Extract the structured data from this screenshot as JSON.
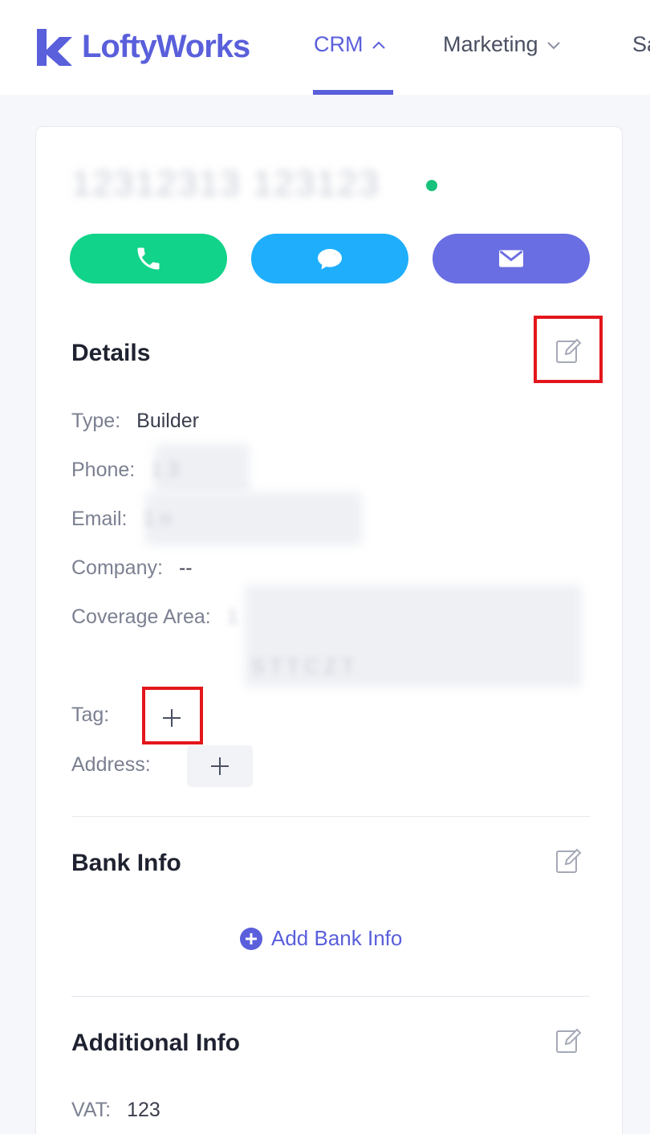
{
  "nav": {
    "logo_text": "LoftyWorks",
    "items": [
      {
        "label": "CRM",
        "active": true
      },
      {
        "label": "Marketing",
        "active": false
      },
      {
        "label": "Sa",
        "active": false
      }
    ],
    "accent_color": "#5a5fdb"
  },
  "contact": {
    "name": "12312313 123123",
    "status": "online",
    "actions": [
      {
        "icon": "phone-icon",
        "color": "#11d38a"
      },
      {
        "icon": "chat-bubble-icon",
        "color": "#1eaefb"
      },
      {
        "icon": "envelope-icon",
        "color": "#6a6ee3"
      }
    ]
  },
  "details": {
    "title": "Details",
    "fields": {
      "type": {
        "label": "Type:",
        "value": "Builder"
      },
      "phone": {
        "label": "Phone:",
        "value": "1     3"
      },
      "email": {
        "label": "Email:",
        "value": "1                        n"
      },
      "company": {
        "label": "Company:",
        "value": "--"
      },
      "coverage_area": {
        "label": "Coverage Area:",
        "value": "1",
        "value_line2": "S T T    C Z T"
      },
      "tag": {
        "label": "Tag:"
      },
      "address": {
        "label": "Address:"
      }
    }
  },
  "bank_info": {
    "title": "Bank Info",
    "add_label": "Add Bank Info"
  },
  "additional_info": {
    "title": "Additional Info",
    "vat_label": "VAT:",
    "vat_value": "123"
  }
}
